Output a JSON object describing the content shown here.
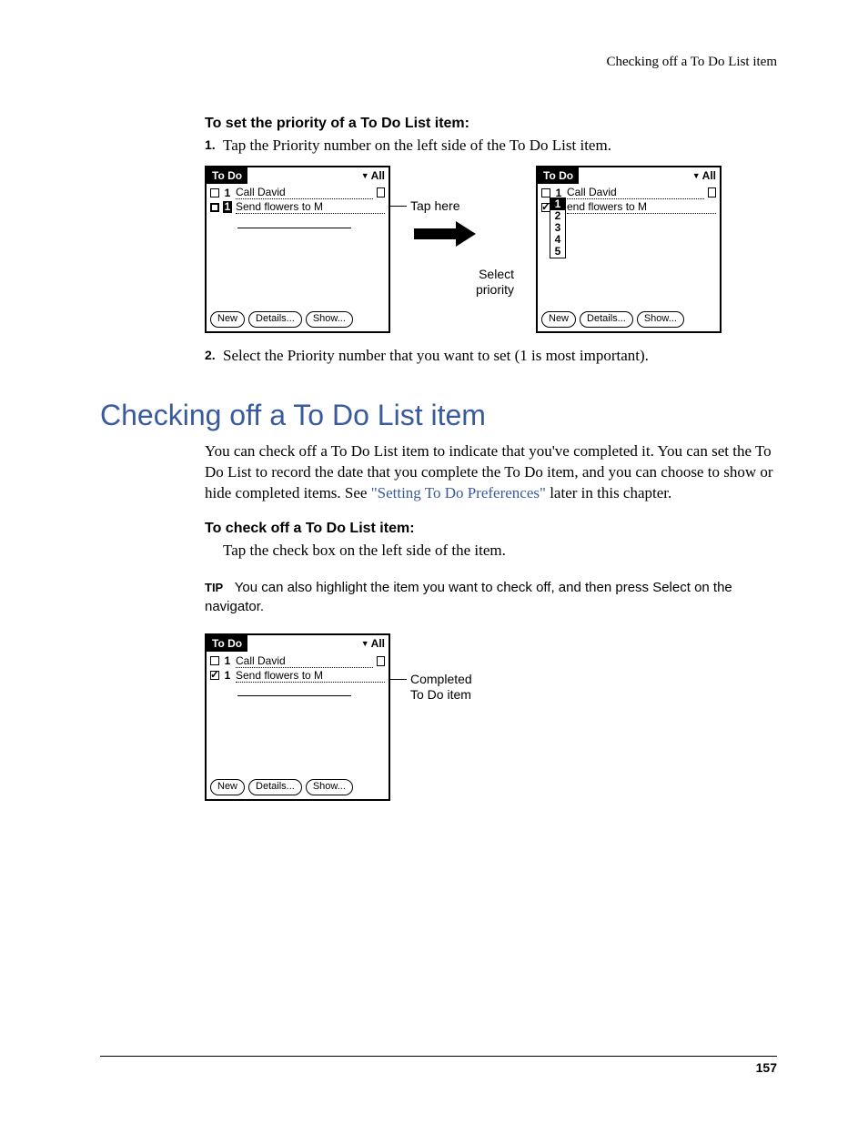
{
  "running_header": "Checking off a To Do List item",
  "sec1": {
    "heading": "To set the priority of a To Do List item:",
    "step1_num": "1.",
    "step1": "Tap the Priority number on the left side of the To Do List item.",
    "step2_num": "2.",
    "step2": "Select the Priority number that you want to set (1 is most important).",
    "callout_tap": "Tap here",
    "callout_select_l1": "Select",
    "callout_select_l2": "priority"
  },
  "h1": "Checking off a To Do List item",
  "para1_a": "You can check off a To Do List item to indicate that you've completed it. You can set the To Do List to record the date that you complete the To Do item, and you can choose to show or hide completed items. See ",
  "para1_link": "\"Setting To Do Preferences\"",
  "para1_b": " later in this chapter.",
  "sec2": {
    "heading": "To check off a To Do List item:",
    "step": "Tap the check box on the left side of the item."
  },
  "tip_label": "TIP",
  "tip_text": "You can also highlight the item you want to check off, and then press Select on the navigator.",
  "callout_completed_l1": "Completed",
  "callout_completed_l2": "To Do item",
  "palm": {
    "title": "To Do",
    "filter": "All",
    "item1": "Call David",
    "item2": "Send flowers to M",
    "item2_trunc": "end flowers to M",
    "btn_new": "New",
    "btn_details": "Details...",
    "btn_show": "Show...",
    "pri": "1",
    "popup": [
      "1",
      "2",
      "3",
      "4",
      "5"
    ]
  },
  "page_number": "157"
}
